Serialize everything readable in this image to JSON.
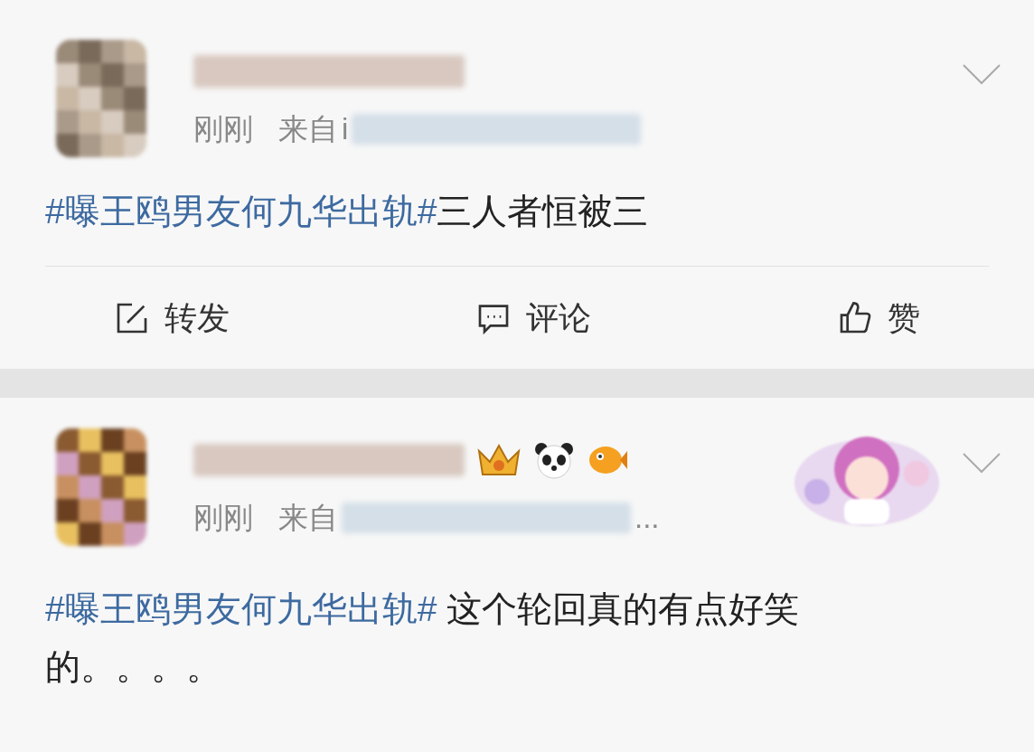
{
  "posts": [
    {
      "time": "刚刚",
      "source_label": "来自",
      "source_start": "i",
      "hashtag": "#曝王鸥男友何九华出轨#",
      "text": "三人者恒被三",
      "actions": [
        {
          "kind": "repost",
          "label": "转发"
        },
        {
          "kind": "comment",
          "label": "评论"
        },
        {
          "kind": "like",
          "label": "赞"
        }
      ]
    },
    {
      "time": "刚刚",
      "source_label": "来自",
      "source_end": "...",
      "badges": [
        {
          "kind": "crown"
        },
        {
          "kind": "panda"
        },
        {
          "kind": "fish"
        }
      ],
      "hashtag": "#曝王鸥男友何九华出轨#",
      "text": " 这个轮回真的有点好笑的。。。。"
    }
  ]
}
